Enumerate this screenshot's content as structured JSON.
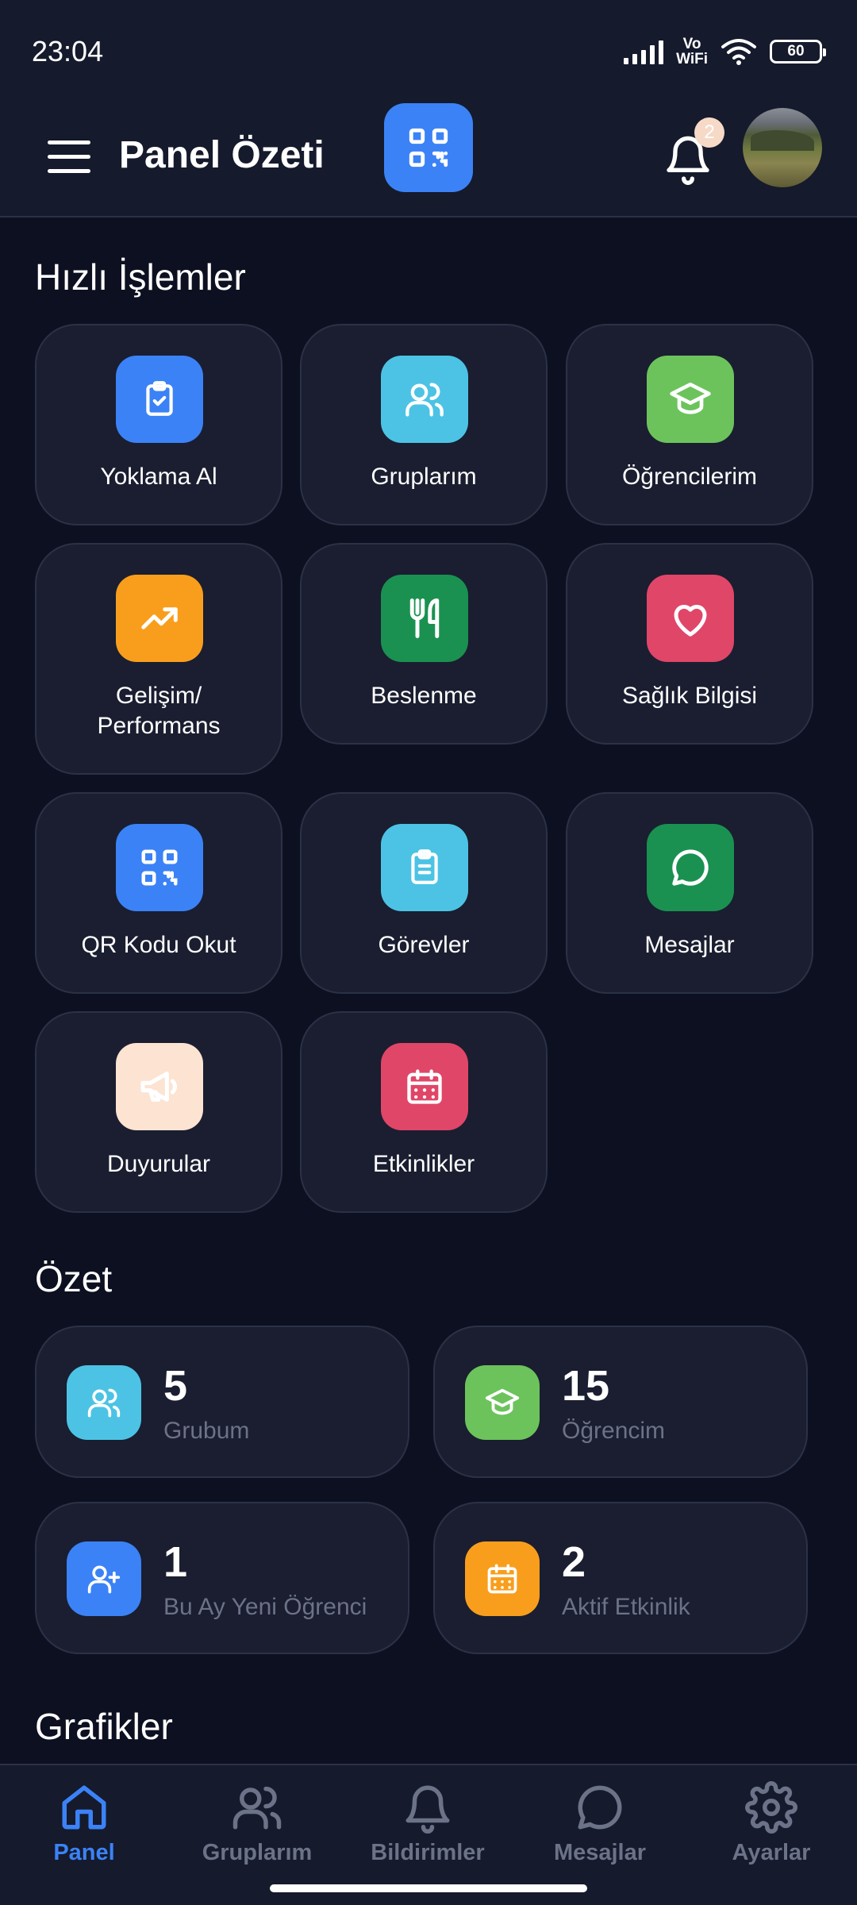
{
  "status_bar": {
    "time": "23:04",
    "network_line1": "Vo",
    "network_line2": "WiFi",
    "battery": "60"
  },
  "header": {
    "title": "Panel Özeti",
    "notification_count": "2",
    "icons": {
      "menu": "menu-icon",
      "qr": "qr-code-icon",
      "bell": "bell-icon"
    }
  },
  "quick_actions": {
    "title": "Hızlı İşlemler",
    "items": [
      {
        "label": "Yoklama Al",
        "icon": "clipboard-check-icon",
        "color": "#3b82f6"
      },
      {
        "label": "Gruplarım",
        "icon": "users-icon",
        "color": "#4cc3e4"
      },
      {
        "label": "Öğrencilerim",
        "icon": "graduation-cap-icon",
        "color": "#6cc35c"
      },
      {
        "label": "Gelişim/ Performans",
        "icon": "trending-up-icon",
        "color": "#f99e1c"
      },
      {
        "label": "Beslenme",
        "icon": "utensils-icon",
        "color": "#1a9150"
      },
      {
        "label": "Sağlık Bilgisi",
        "icon": "heart-icon",
        "color": "#e04668"
      },
      {
        "label": "QR Kodu Okut",
        "icon": "qr-code-icon",
        "color": "#3b82f6"
      },
      {
        "label": "Görevler",
        "icon": "clipboard-list-icon",
        "color": "#4cc3e4"
      },
      {
        "label": "Mesajlar",
        "icon": "message-circle-icon",
        "color": "#1a9150"
      },
      {
        "label": "Duyurular",
        "icon": "megaphone-icon",
        "color": "#fce3d2"
      },
      {
        "label": "Etkinlikler",
        "icon": "calendar-icon",
        "color": "#e04668"
      }
    ]
  },
  "summary": {
    "title": "Özet",
    "cards": [
      {
        "value": "5",
        "caption": "Grubum",
        "icon": "users-icon",
        "color": "#4cc3e4"
      },
      {
        "value": "15",
        "caption": "Öğrencim",
        "icon": "graduation-cap-icon",
        "color": "#6cc35c"
      },
      {
        "value": "1",
        "caption": "Bu Ay Yeni Öğrenci",
        "icon": "user-plus-icon",
        "color": "#3b82f6"
      },
      {
        "value": "2",
        "caption": "Aktif Etkinlik",
        "icon": "calendar-icon",
        "color": "#f99e1c"
      }
    ]
  },
  "charts_section": {
    "title": "Grafikler"
  },
  "bottom_nav": {
    "items": [
      {
        "label": "Panel",
        "icon": "home-icon",
        "active": true
      },
      {
        "label": "Gruplarım",
        "icon": "users-icon",
        "active": false
      },
      {
        "label": "Bildirimler",
        "icon": "bell-icon",
        "active": false
      },
      {
        "label": "Mesajlar",
        "icon": "message-circle-icon",
        "active": false
      },
      {
        "label": "Ayarlar",
        "icon": "gear-icon",
        "active": false
      }
    ]
  },
  "colors": {
    "background": "#0d1020",
    "header": "#151a2c",
    "card": "#1a1e30",
    "accent": "#3b82f6",
    "muted_text": "#6c7287"
  }
}
